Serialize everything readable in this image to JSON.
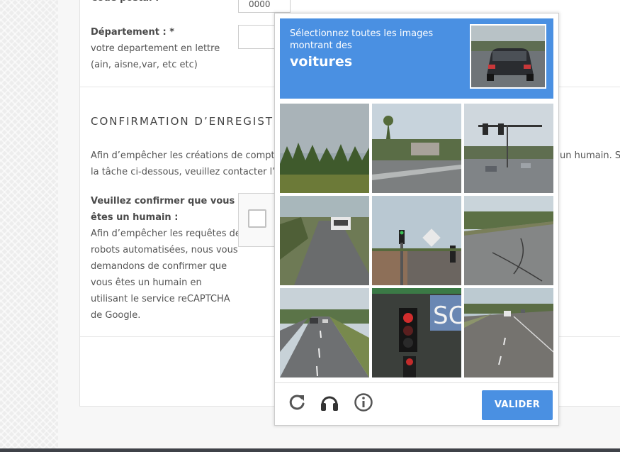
{
  "form": {
    "postal_label": "Code postal :",
    "postal_value": "0000",
    "dept_label": "Département : *",
    "dept_help_1": "votre departement en lettre",
    "dept_help_2": "(ain, aisne,var, etc etc)",
    "section_title": "CONFIRMATION D’ENREGISTR",
    "intro_line_1": "Afin d’empêcher les créations de comptes a",
    "intro_line_1_right": "un humain. Si",
    "intro_line_2": "la tâche ci-dessous, veuillez contacter l’adm",
    "confirm_label_1": "Veuillez confirmer que vous",
    "confirm_label_2": "êtes un humain :",
    "confirm_help": [
      "Afin d’empêcher les requêtes de",
      "robots automatisées, nous vous",
      "demandons de confirmer que",
      "vous êtes un humain en",
      "utilisant le service reCAPTCHA",
      "de Google."
    ]
  },
  "challenge": {
    "instruction_1": "Sélectionnez toutes les images",
    "instruction_2": "montrant des",
    "keyword": "voitures",
    "verify_label": "VALIDER",
    "icons": [
      "reload-icon",
      "headphones-icon",
      "info-icon"
    ]
  },
  "colors": {
    "accent": "#4a90e2",
    "bottom_bar": "#3f4248"
  }
}
